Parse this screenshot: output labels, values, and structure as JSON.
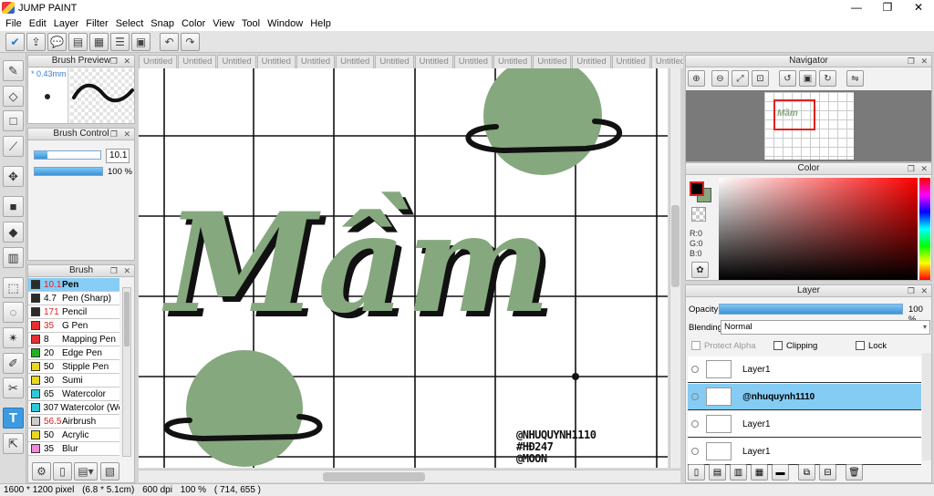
{
  "app": {
    "title": "JUMP PAINT",
    "window_buttons": [
      "—",
      "❐",
      "✕"
    ]
  },
  "menu": [
    "File",
    "Edit",
    "Layer",
    "Filter",
    "Select",
    "Snap",
    "Color",
    "View",
    "Tool",
    "Window",
    "Help"
  ],
  "toolbar": {
    "icons": [
      "check-icon",
      "export-icon",
      "comment-icon",
      "message-icon",
      "document-icon",
      "list-icon",
      "layout-icon",
      "undo-icon",
      "redo-icon"
    ],
    "glyphs": [
      "✔",
      "⇪",
      "💬",
      "▤",
      "▦",
      "☰",
      "▣",
      "↶",
      "↷"
    ]
  },
  "tools": {
    "icons": [
      "pen-tool-icon",
      "eraser-tool-icon",
      "shape-tool-icon",
      "line-tool-icon",
      "move-tool-icon",
      "fill-rect-tool-icon",
      "bucket-tool-icon",
      "gradient-tool-icon",
      "rect-select-icon",
      "lasso-select-icon",
      "magic-wand-icon",
      "select-pen-icon",
      "select-eraser-icon",
      "text-tool-icon",
      "hand-tool-icon"
    ],
    "glyphs": [
      "✎",
      "◇",
      "□",
      "⟋",
      "✥",
      "■",
      "◆",
      "▥",
      "⬚",
      "◌",
      "✴",
      "✐",
      "✂",
      "T",
      "⇱"
    ]
  },
  "brush_preview": {
    "title": "Brush Preview",
    "size_label": "* 0.43mm"
  },
  "brush_control": {
    "title": "Brush Control",
    "size_value": "10.1",
    "size_fraction": 0.2,
    "opacity_value": "100 %",
    "opacity_fraction": 1.0
  },
  "brush": {
    "title": "Brush",
    "items": [
      {
        "size": "10.1",
        "name": "Pen",
        "color": "#2b2b2b",
        "red": true
      },
      {
        "size": "4.7",
        "name": "Pen (Sharp)",
        "color": "#2b2b2b",
        "red": false
      },
      {
        "size": "171",
        "name": "Pencil",
        "color": "#2b2b2b",
        "red": true
      },
      {
        "size": "35",
        "name": "G Pen",
        "color": "#e03030",
        "red": true
      },
      {
        "size": "8",
        "name": "Mapping Pen",
        "color": "#e03030",
        "red": false
      },
      {
        "size": "20",
        "name": "Edge Pen",
        "color": "#20b020",
        "red": false
      },
      {
        "size": "50",
        "name": "Stipple Pen",
        "color": "#e8d820",
        "red": false
      },
      {
        "size": "30",
        "name": "Sumi",
        "color": "#e8d820",
        "red": false
      },
      {
        "size": "65",
        "name": "Watercolor",
        "color": "#30c8d8",
        "red": false
      },
      {
        "size": "307",
        "name": "Watercolor (We",
        "color": "#30c8d8",
        "red": false
      },
      {
        "size": "56.5",
        "name": "Airbrush",
        "color": "#cccccc",
        "red": true
      },
      {
        "size": "50",
        "name": "Acrylic",
        "color": "#e8d820",
        "red": false
      },
      {
        "size": "35",
        "name": "Blur",
        "color": "#f08ad8",
        "red": false
      }
    ]
  },
  "tabs": [
    "Untitled",
    "Untitled",
    "Untitled",
    "Untitled",
    "Untitled",
    "Untitled",
    "Untitled",
    "Untitled",
    "Untitled",
    "Untitled",
    "Untitled",
    "Untitled",
    "Untitled",
    "Untitled",
    "Untitled"
  ],
  "artwork": {
    "text": "Mầm",
    "watermark": [
      "@NHUQUYNH1110",
      "#HĐ247",
      "@MOON"
    ],
    "fill_color": "#86a87e",
    "ink_color": "#111111"
  },
  "navigator": {
    "title": "Navigator"
  },
  "color": {
    "title": "Color",
    "r": "R:0",
    "g": "G:0",
    "b": "B:0",
    "foreground": "#000000",
    "background": "#86a87e"
  },
  "layer": {
    "title": "Layer",
    "opacity_label": "Opacity",
    "opacity_value": "100 %",
    "opacity_fraction": 1.0,
    "blending_label": "Blending",
    "blending_value": "Normal",
    "protect_alpha": "Protect Alpha",
    "clipping": "Clipping",
    "lock": "Lock",
    "layers": [
      {
        "name": "Layer1",
        "selected": false
      },
      {
        "name": "@nhuquynh1110",
        "selected": true
      },
      {
        "name": "Layer1",
        "selected": false
      },
      {
        "name": "Layer1",
        "selected": false
      }
    ]
  },
  "status": {
    "pixels": "1600 * 1200 pixel",
    "size_cm": "(6.8 * 5.1cm)",
    "dpi": "600 dpi",
    "zoom": "100 %",
    "coords": "( 714, 655 )"
  }
}
